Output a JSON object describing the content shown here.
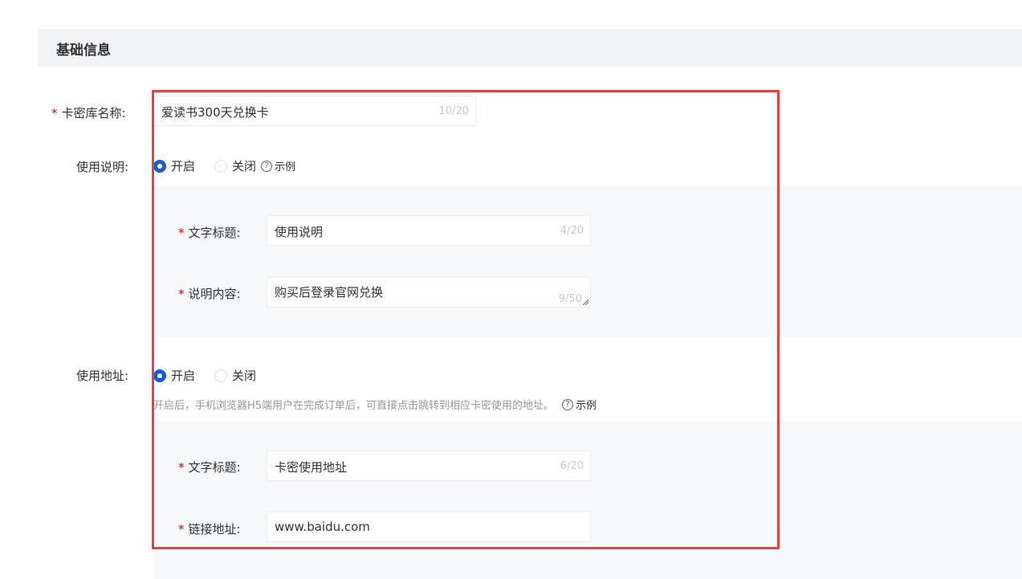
{
  "section": {
    "title": "基础信息"
  },
  "fields": {
    "name": {
      "label": "卡密库名称:",
      "value": "爱读书300天兑换卡",
      "count": "10/20"
    },
    "usage_desc": {
      "label": "使用说明:",
      "options": {
        "on": "开启",
        "off": "关闭"
      },
      "selected": "开启",
      "example": "示例",
      "title": {
        "label": "文字标题:",
        "value": "使用说明",
        "count": "4/20"
      },
      "content": {
        "label": "说明内容:",
        "value": "购买后登录官网兑换",
        "count": "9/50"
      }
    },
    "usage_url": {
      "label": "使用地址:",
      "options": {
        "on": "开启",
        "off": "关闭"
      },
      "selected": "开启",
      "hint": "开启后，手机浏览器H5端用户在完成订单后，可直接点击跳转到相应卡密使用的地址。",
      "example": "示例",
      "title": {
        "label": "文字标题:",
        "value": "卡密使用地址",
        "count": "6/20"
      },
      "link": {
        "label": "链接地址:",
        "value": "www.baidu.com"
      }
    }
  },
  "colors": {
    "highlight": "#e84040",
    "accent": "#155bd4",
    "required": "#d40000"
  }
}
